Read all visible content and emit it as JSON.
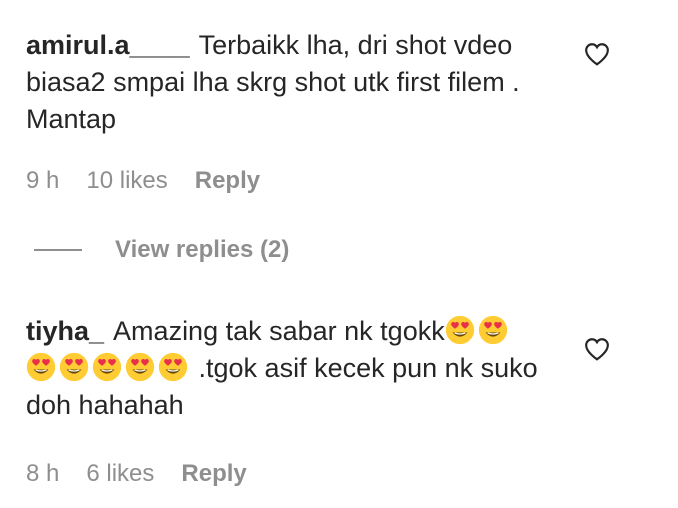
{
  "comments": [
    {
      "username": "amirul.a____",
      "text": "Terbaikk lha, dri shot vdeo biasa2 smpai lha skrg shot utk first filem . Mantap",
      "emojis_inline": [],
      "text_after_emojis": "",
      "time": "9 h",
      "likes": "10 likes",
      "reply_label": "Reply"
    },
    {
      "username": "tiyha_",
      "text": "Amazing tak sabar nk tgokk",
      "emojis_inline": [
        "smiling-face-heart-eyes",
        "smiling-face-heart-eyes",
        "smiling-face-heart-eyes",
        "smiling-face-heart-eyes",
        "smiling-face-heart-eyes",
        "smiling-face-heart-eyes",
        "smiling-face-heart-eyes"
      ],
      "text_after_emojis": ".tgok asif kecek pun nk suko doh hahahah",
      "time": "8 h",
      "likes": "6 likes",
      "reply_label": "Reply"
    }
  ],
  "view_replies": {
    "label": "View replies (2)"
  },
  "icons": {
    "like": "heart-outline-icon",
    "emoji": "smiling-face-with-heart-eyes"
  },
  "colors": {
    "text": "#262626",
    "meta": "#8e8e8e",
    "emoji_face": "#ffcc33",
    "emoji_heart": "#e8304b"
  }
}
